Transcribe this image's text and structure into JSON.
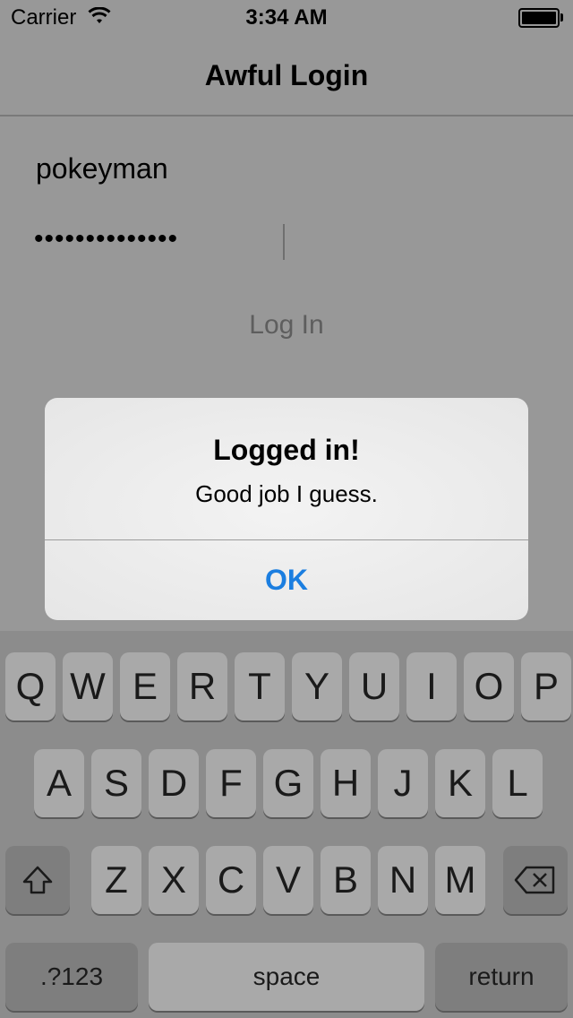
{
  "status_bar": {
    "carrier": "Carrier",
    "time": "3:34 AM"
  },
  "nav": {
    "title": "Awful Login"
  },
  "form": {
    "username_value": "pokeyman",
    "password_masked": "••••••••••••••",
    "login_label": "Log In"
  },
  "alert": {
    "title": "Logged in!",
    "message": "Good job I guess.",
    "ok_label": "OK"
  },
  "keyboard": {
    "row1": [
      "Q",
      "W",
      "E",
      "R",
      "T",
      "Y",
      "U",
      "I",
      "O",
      "P"
    ],
    "row2": [
      "A",
      "S",
      "D",
      "F",
      "G",
      "H",
      "J",
      "K",
      "L"
    ],
    "row3": [
      "Z",
      "X",
      "C",
      "V",
      "B",
      "N",
      "M"
    ],
    "numbers_label": ".?123",
    "space_label": "space",
    "return_label": "return",
    "shift_icon": "shift-icon",
    "delete_icon": "delete-icon"
  },
  "colors": {
    "accent": "#1b7ee0"
  }
}
